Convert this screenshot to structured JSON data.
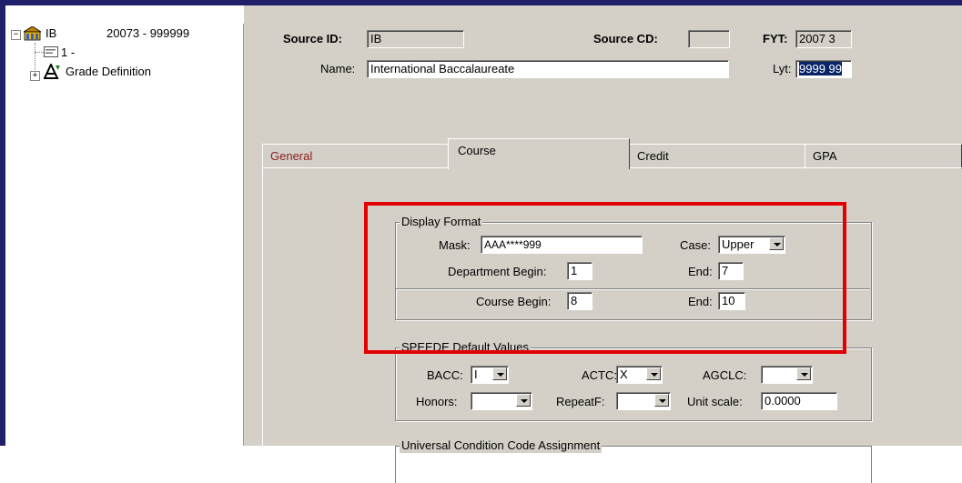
{
  "tree": {
    "root": {
      "label": "IB",
      "range": "20073 - 999999"
    },
    "child1": {
      "label": "1 -"
    },
    "child2": {
      "label": "Grade Definition"
    }
  },
  "header": {
    "source_id_label": "Source ID:",
    "source_id_value": "IB",
    "source_cd_label": "Source CD:",
    "source_cd_value": "",
    "fyt_label": "FYT:",
    "fyt_value": "2007 3",
    "name_label": "Name:",
    "name_value": "International Baccalaureate",
    "lyt_label": "Lyt:",
    "lyt_value": "9999 99"
  },
  "tabs": [
    {
      "label": "General"
    },
    {
      "label": "Course"
    },
    {
      "label": "Credit"
    },
    {
      "label": "GPA"
    }
  ],
  "display_format": {
    "title": "Display Format",
    "mask_label": "Mask:",
    "mask_value": "AAA****999",
    "case_label": "Case:",
    "case_value": "Upper",
    "dept_begin_label": "Department Begin:",
    "dept_begin_value": "1",
    "dept_end_label": "End:",
    "dept_end_value": "7",
    "course_begin_label": "Course Begin:",
    "course_begin_value": "8",
    "course_end_label": "End:",
    "course_end_value": "10"
  },
  "speede": {
    "title": "SPEEDE Default Values",
    "bacc_label": "BACC:",
    "bacc_value": "I",
    "actc_label": "ACTC:",
    "actc_value": "X",
    "agclc_label": "AGCLC:",
    "agclc_value": "",
    "honors_label": "Honors:",
    "honors_value": "",
    "repeatf_label": "RepeatF:",
    "repeatf_value": "",
    "unit_scale_label": "Unit scale:",
    "unit_scale_value": "0.0000"
  },
  "universal": {
    "title": "Universal Condition Code Assignment"
  },
  "colors": {
    "highlight": "#e30000",
    "panel": "#d4d0c8",
    "frame": "#1f1f6a",
    "selection": "#0a246a"
  }
}
